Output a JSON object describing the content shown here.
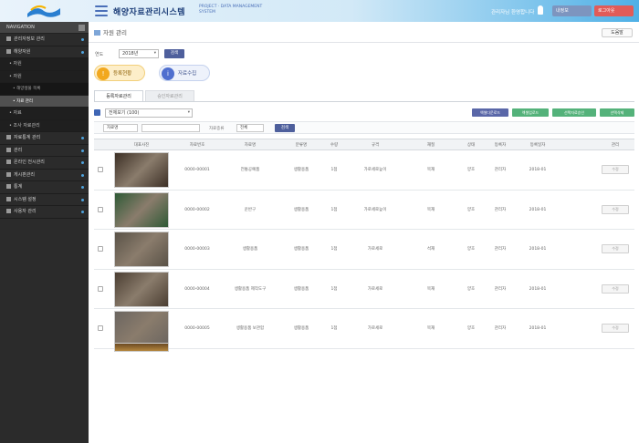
{
  "header": {
    "brand_kr": "해양자료관리시스템",
    "brand_en": "PROJECT · DATA MANAGEMENT SYSTEM",
    "user": "관리자님 환영합니다",
    "mypage_label": "내정보",
    "logout_label": "로그아웃"
  },
  "sidebar": {
    "head": "NAVIGATION",
    "items": [
      {
        "label": "관리자정보 관리",
        "level": 0
      },
      {
        "label": "해양자원",
        "level": 0
      },
      {
        "label": "• 자원",
        "level": 1
      },
      {
        "label": "• 자원",
        "level": 1
      },
      {
        "label": "• 해양생물 목록",
        "level": 2
      },
      {
        "label": "• 자료 관리",
        "level": 2,
        "active": true
      },
      {
        "label": "• 자료",
        "level": 1
      },
      {
        "label": "• 조사 자료관리",
        "level": 1
      },
      {
        "label": "자료통계 관리",
        "level": 0
      },
      {
        "label": "관리",
        "level": 0
      },
      {
        "label": "온라인 전시관리",
        "level": 0
      },
      {
        "label": "게시판관리",
        "level": 0
      },
      {
        "label": "통계",
        "level": 0
      },
      {
        "label": "시스템 설정",
        "level": 0
      },
      {
        "label": "사용자 관리",
        "level": 0
      }
    ]
  },
  "page": {
    "title": "자원 관리",
    "help_label": "도움말",
    "year_label": "연도",
    "year_value": "2018년",
    "search_label": "검색"
  },
  "pills": [
    {
      "icon": "!",
      "label": "등록현황"
    },
    {
      "icon": "i",
      "label": "자료수집"
    }
  ],
  "tabs": [
    {
      "label": "등록자료관리",
      "active": true
    },
    {
      "label": "승인자료관리",
      "active": false
    }
  ],
  "list": {
    "select_value": "전체보기 (100)",
    "actions": [
      {
        "label": "엑셀다운로드",
        "color": "#5a67a8"
      },
      {
        "label": "엑셀업로드",
        "color": "#54b27a"
      },
      {
        "label": "선택자료승인",
        "color": "#54b27a"
      },
      {
        "label": "선택삭제",
        "color": "#54b27a"
      }
    ]
  },
  "search": {
    "field_value": "자료명",
    "type_label": "자료종류",
    "type_value": "전체",
    "button_label": "검색"
  },
  "table": {
    "columns": [
      "",
      "대표사진",
      "자료번호",
      "자료명",
      "분류명",
      "수량",
      "규격",
      "재질",
      "상태",
      "등록자",
      "등록일자",
      "관리"
    ],
    "rows": [
      {
        "no": "0000-00001",
        "name": "전통공예품",
        "cat": "생활용품",
        "qty": "1점",
        "spec": "가로세로높이",
        "mat": "목재",
        "state": "양호",
        "user": "관리자",
        "date": "2018-01",
        "edit": "수정",
        "thumb": "#3c2f25"
      },
      {
        "no": "0000-00002",
        "name": "운반구",
        "cat": "생활용품",
        "qty": "1점",
        "spec": "가로세로높이",
        "mat": "목재",
        "state": "양호",
        "user": "관리자",
        "date": "2018-01",
        "edit": "수정",
        "thumb": "#2f5a36"
      },
      {
        "no": "0000-00003",
        "name": "생활용품",
        "cat": "생활용품",
        "qty": "1점",
        "spec": "가로세로",
        "mat": "석재",
        "state": "양호",
        "user": "관리자",
        "date": "2018-01",
        "edit": "수정",
        "thumb": "#5a5247"
      },
      {
        "no": "0000-00004",
        "name": "생활용품 제작도구",
        "cat": "생활용품",
        "qty": "1점",
        "spec": "가로세로",
        "mat": "목재",
        "state": "양호",
        "user": "관리자",
        "date": "2018-01",
        "edit": "수정",
        "thumb": "#4b3e32"
      },
      {
        "no": "0000-00005",
        "name": "생활용품 보관함",
        "cat": "생활용품",
        "qty": "1점",
        "spec": "가로세로",
        "mat": "목재",
        "state": "양호",
        "user": "관리자",
        "date": "2018-01",
        "edit": "수정",
        "thumb": "#6b6560"
      }
    ]
  },
  "colors": {
    "accent": "#4e5f9c",
    "sidebar_bg": "#2b2b2b",
    "logout": "#e15b58"
  }
}
